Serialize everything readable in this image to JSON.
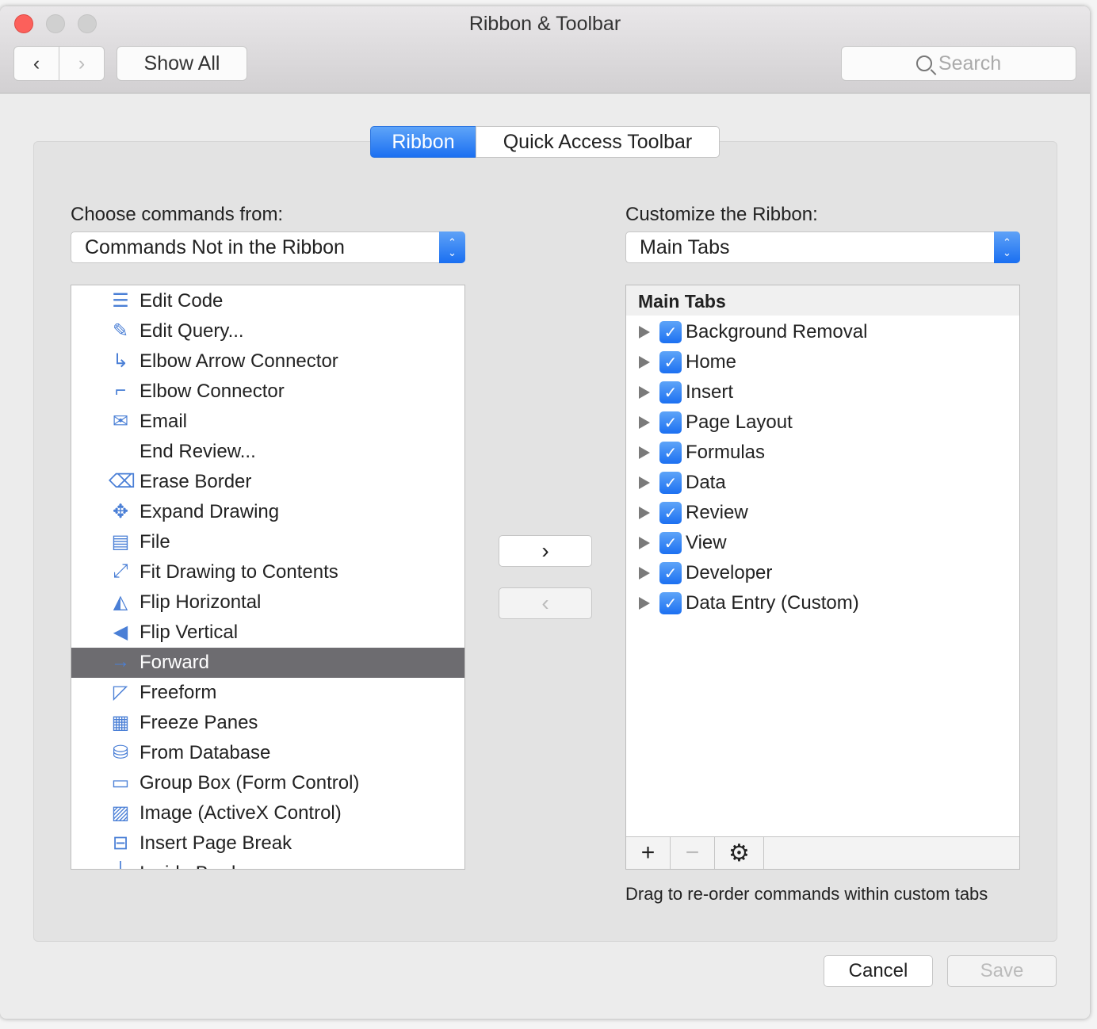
{
  "window": {
    "title": "Ribbon & Toolbar"
  },
  "toolbar": {
    "back": "‹",
    "forward": "›",
    "show_all": "Show All",
    "search_placeholder": "Search"
  },
  "tabs": [
    {
      "label": "Ribbon",
      "active": true
    },
    {
      "label": "Quick Access Toolbar",
      "active": false
    }
  ],
  "left": {
    "label": "Choose commands from:",
    "popup_value": "Commands Not in the Ribbon",
    "items": [
      {
        "label": "Edit Code",
        "icon": "edit-code-icon"
      },
      {
        "label": "Edit Query...",
        "icon": "edit-query-icon"
      },
      {
        "label": "Elbow Arrow Connector",
        "icon": "elbow-arrow-connector-icon"
      },
      {
        "label": "Elbow Connector",
        "icon": "elbow-connector-icon"
      },
      {
        "label": "Email",
        "icon": "email-icon"
      },
      {
        "label": "End Review...",
        "icon": ""
      },
      {
        "label": "Erase Border",
        "icon": "eraser-icon"
      },
      {
        "label": "Expand Drawing",
        "icon": "expand-drawing-icon"
      },
      {
        "label": "File",
        "icon": "file-icon"
      },
      {
        "label": "Fit Drawing to Contents",
        "icon": "fit-drawing-icon"
      },
      {
        "label": "Flip Horizontal",
        "icon": "flip-horizontal-icon"
      },
      {
        "label": "Flip Vertical",
        "icon": "flip-vertical-icon"
      },
      {
        "label": "Forward",
        "icon": "forward-arrow-icon",
        "selected": true
      },
      {
        "label": "Freeform",
        "icon": "freeform-icon"
      },
      {
        "label": "Freeze Panes",
        "icon": "freeze-panes-icon"
      },
      {
        "label": "From Database",
        "icon": "database-icon"
      },
      {
        "label": "Group Box (Form Control)",
        "icon": "group-box-icon"
      },
      {
        "label": "Image (ActiveX Control)",
        "icon": "image-icon"
      },
      {
        "label": "Insert Page Break",
        "icon": "page-break-icon"
      },
      {
        "label": "Inside Borders",
        "icon": "inside-borders-icon"
      }
    ]
  },
  "move": {
    "add": "›",
    "remove": "‹"
  },
  "right": {
    "label": "Customize the Ribbon:",
    "popup_value": "Main Tabs",
    "header": "Main Tabs",
    "items": [
      {
        "label": "Background Removal",
        "checked": true
      },
      {
        "label": "Home",
        "checked": true
      },
      {
        "label": "Insert",
        "checked": true
      },
      {
        "label": "Page Layout",
        "checked": true
      },
      {
        "label": "Formulas",
        "checked": true
      },
      {
        "label": "Data",
        "checked": true
      },
      {
        "label": "Review",
        "checked": true
      },
      {
        "label": "View",
        "checked": true
      },
      {
        "label": "Developer",
        "checked": true
      },
      {
        "label": "Data Entry (Custom)",
        "checked": true
      }
    ],
    "add": "+",
    "remove": "−",
    "settings": "⚙",
    "hint": "Drag to re-order commands within custom tabs"
  },
  "footer": {
    "cancel": "Cancel",
    "save": "Save"
  },
  "colors": {
    "accent": "#1a6ff1",
    "selection": "#6d6c70",
    "close": "#fc605b"
  }
}
